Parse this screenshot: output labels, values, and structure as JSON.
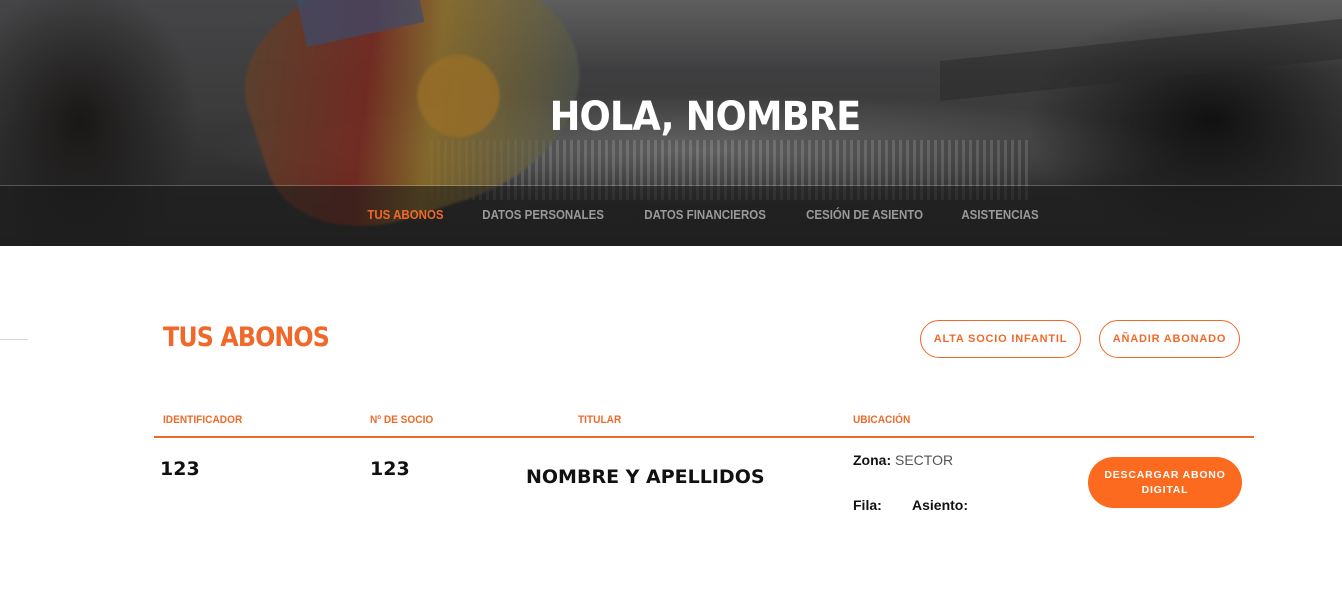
{
  "hero": {
    "greeting": "HOLA, NOMBRE"
  },
  "subnav": {
    "items": [
      {
        "label": "TUS ABONOS",
        "active": true
      },
      {
        "label": "DATOS PERSONALES",
        "active": false
      },
      {
        "label": "DATOS FINANCIEROS",
        "active": false
      },
      {
        "label": "CESIÓN DE ASIENTO",
        "active": false
      },
      {
        "label": "ASISTENCIAS",
        "active": false
      }
    ]
  },
  "section": {
    "title": "TUS ABONOS",
    "buttons": {
      "alta_infantil": "ALTA SOCIO INFANTIL",
      "anadir_abonado": "AÑADIR ABONADO"
    }
  },
  "table": {
    "headers": {
      "identificador": "IDENTIFICADOR",
      "socio": "Nº DE SOCIO",
      "titular": "TITULAR",
      "ubicacion": "UBICACIÓN"
    },
    "rows": [
      {
        "identificador": "123",
        "socio": "123",
        "titular": "NOMBRE Y APELLIDOS",
        "zona_label": "Zona:",
        "zona_value": "SECTOR",
        "fila_label": "Fila:",
        "asiento_label": "Asiento:",
        "download_label": "DESCARGAR ABONO DIGITAL"
      }
    ]
  },
  "colors": {
    "accent": "#ef6a2a",
    "button_fill": "#fb6a1e",
    "inactive_nav": "#9a9a9a"
  }
}
